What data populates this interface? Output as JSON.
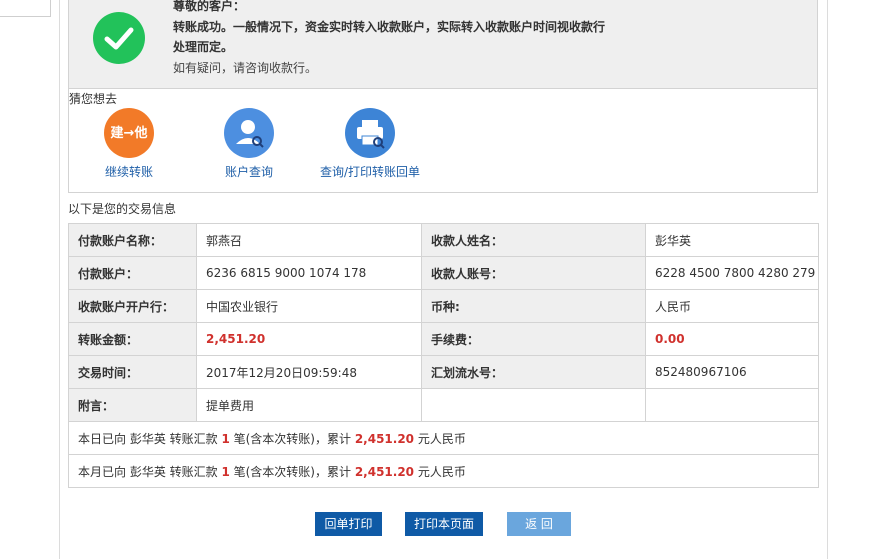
{
  "success": {
    "greeting": "尊敬的客户：",
    "line1": "转账成功。一般情况下，资金实时转入收款账户，实际转入收款账户时间视收款行",
    "line2": "处理而定。",
    "line3": "如有疑问，请咨询收款行。"
  },
  "guess": {
    "title": "猜您想去",
    "items": [
      {
        "label": "继续转账",
        "icon_text": "建→他"
      },
      {
        "label": "账户查询"
      },
      {
        "label": "查询/打印转账回单"
      }
    ]
  },
  "info_title": "以下是您的交易信息",
  "rows": [
    {
      "l1": "付款账户名称：",
      "v1": "郭燕召",
      "l2": "收款人姓名：",
      "v2": "彭华英"
    },
    {
      "l1": "付款账户：",
      "v1": "6236 6815 9000 1074 178",
      "l2": "收款人账号：",
      "v2": "6228 4500 7800 4280 279"
    },
    {
      "l1": "收款账户开户行：",
      "v1": "中国农业银行",
      "l2": "币种:",
      "v2": "人民币"
    },
    {
      "l1": "转账金额：",
      "v1": "2,451.20",
      "l2": "手续费：",
      "v2": "0.00"
    },
    {
      "l1": "交易时间：",
      "v1": "2017年12月20日09:59:48",
      "l2": "汇划流水号：",
      "v2": "852480967106"
    },
    {
      "l1": "附言：",
      "v1": "提单费用",
      "l2": "",
      "v2": ""
    }
  ],
  "summary": {
    "day": {
      "a": "本日已向 彭华英 转账汇款 ",
      "count": "1",
      "b": " 笔(含本次转账)，累计 ",
      "amount": "2,451.20",
      "c": " 元人民币"
    },
    "month": {
      "a": "本月已向 彭华英 转账汇款 ",
      "count": "1",
      "b": " 笔(含本次转账)，累计 ",
      "amount": "2,451.20",
      "c": " 元人民币"
    }
  },
  "buttons": {
    "print_receipt": "回单打印",
    "print_page": "打印本页面",
    "back": "返 回"
  },
  "colors": {
    "success_green": "#22c25a",
    "link_blue": "#1f5fa8",
    "amount_red": "#d0312d",
    "button_blue": "#0f5aa6",
    "button_light": "#6aa6dd"
  }
}
